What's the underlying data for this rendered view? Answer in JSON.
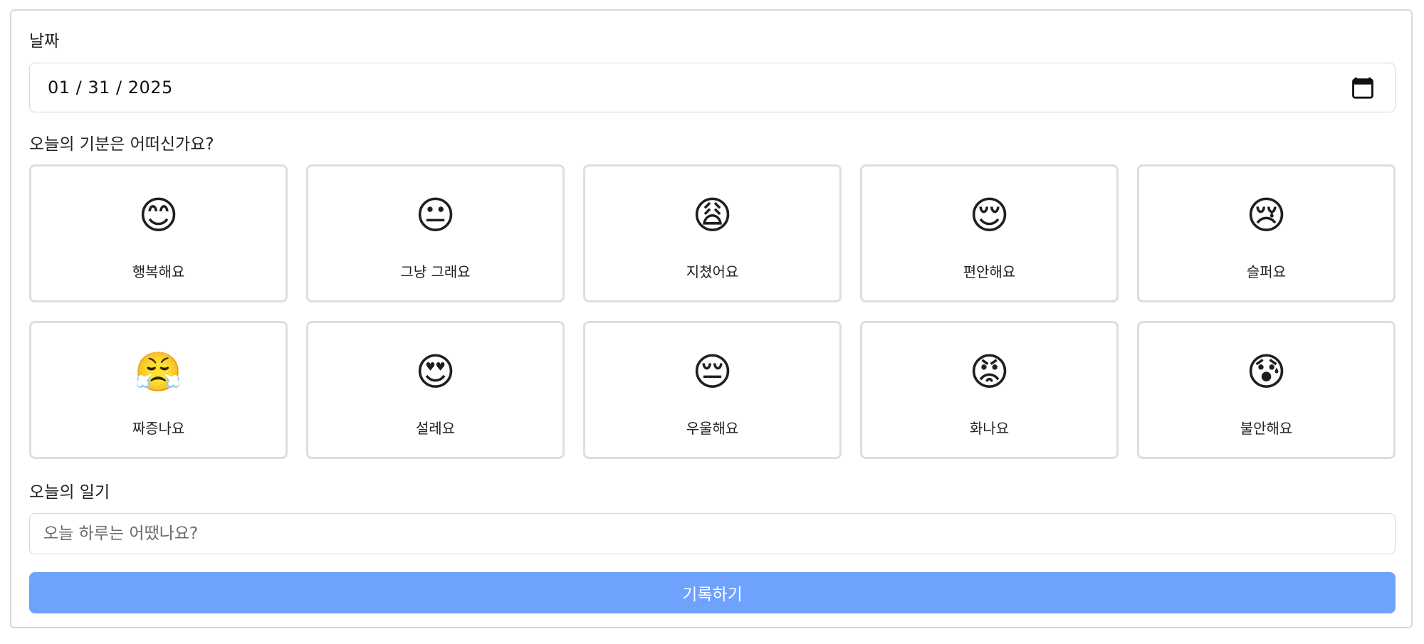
{
  "date_section": {
    "label": "날짜",
    "value": "01 / 31 / 2025",
    "icon": "calendar-icon"
  },
  "mood_section": {
    "label": "오늘의 기분은 어떠신가요?",
    "options": [
      {
        "emoji": "😊",
        "label": "행복해요"
      },
      {
        "emoji": "😐",
        "label": "그냥 그래요"
      },
      {
        "emoji": "😩",
        "label": "지쳤어요"
      },
      {
        "emoji": "😌",
        "label": "편안해요"
      },
      {
        "emoji": "😢",
        "label": "슬퍼요"
      },
      {
        "emoji": "😤",
        "label": "짜증나요"
      },
      {
        "emoji": "😍",
        "label": "설레요"
      },
      {
        "emoji": "😔",
        "label": "우울해요"
      },
      {
        "emoji": "😡",
        "label": "화나요"
      },
      {
        "emoji": "😰",
        "label": "불안해요"
      }
    ]
  },
  "diary_section": {
    "label": "오늘의 일기",
    "placeholder": "오늘 하루는 어땠나요?",
    "value": ""
  },
  "submit": {
    "label": "기록하기",
    "color": "#6ea2fd"
  }
}
